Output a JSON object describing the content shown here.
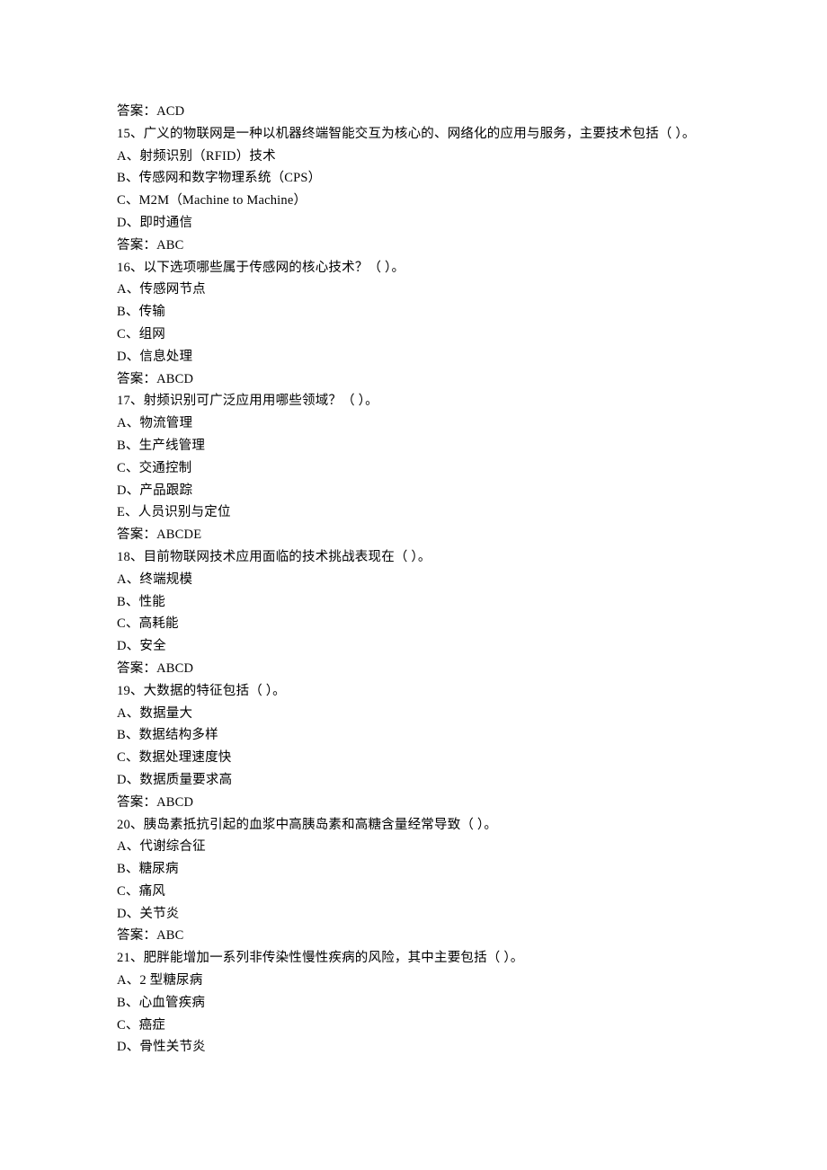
{
  "answer_label": "答案：",
  "lead_answer": "ACD",
  "questions": [
    {
      "num": "15",
      "stem": "广义的物联网是一种以机器终端智能交互为核心的、网络化的应用与服务，主要技术包括（ ）。",
      "options": [
        "A、射频识别（RFID）技术",
        "B、传感网和数字物理系统（CPS）",
        "C、M2M（Machine to Machine）",
        "D、即时通信"
      ],
      "answer": "ABC"
    },
    {
      "num": "16",
      "stem": "以下选项哪些属于传感网的核心技术？（ ）。",
      "options": [
        "A、传感网节点",
        "B、传输",
        "C、组网",
        "D、信息处理"
      ],
      "answer": "ABCD"
    },
    {
      "num": "17",
      "stem": "射频识别可广泛应用用哪些领域？（ ）。",
      "options": [
        "A、物流管理",
        "B、生产线管理",
        "C、交通控制",
        "D、产品跟踪",
        "E、人员识别与定位"
      ],
      "answer": "ABCDE"
    },
    {
      "num": "18",
      "stem": "目前物联网技术应用面临的技术挑战表现在（ ）。",
      "options": [
        "A、终端规模",
        "B、性能",
        "C、高耗能",
        "D、安全"
      ],
      "answer": "ABCD"
    },
    {
      "num": "19",
      "stem": "大数据的特征包括（ ）。",
      "options": [
        "A、数据量大",
        "B、数据结构多样",
        "C、数据处理速度快",
        "D、数据质量要求高"
      ],
      "answer": "ABCD"
    },
    {
      "num": "20",
      "stem": "胰岛素抵抗引起的血浆中高胰岛素和高糖含量经常导致（ ）。",
      "options": [
        "A、代谢综合征",
        "B、糖尿病",
        "C、痛风",
        "D、关节炎"
      ],
      "answer": "ABC"
    },
    {
      "num": "21",
      "stem": "肥胖能增加一系列非传染性慢性疾病的风险，其中主要包括（ ）。",
      "options": [
        "A、2 型糖尿病",
        "B、心血管疾病",
        "C、癌症",
        "D、骨性关节炎"
      ],
      "answer": null
    }
  ]
}
